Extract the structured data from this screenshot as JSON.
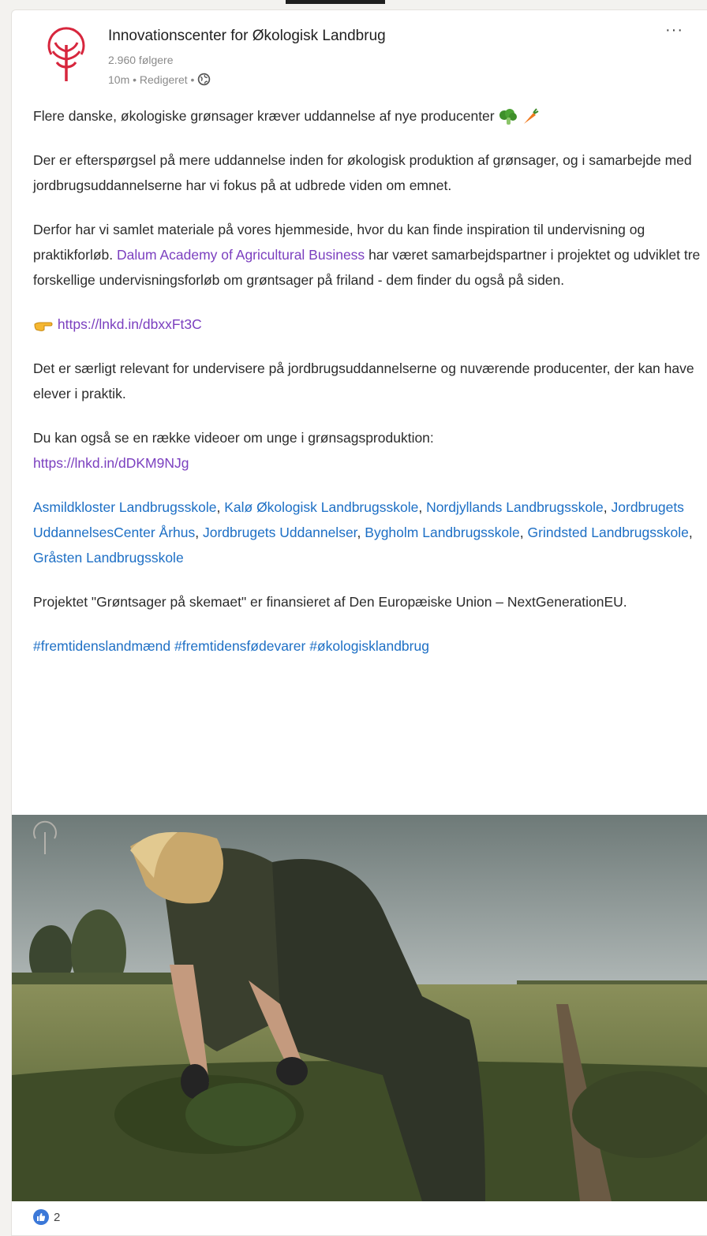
{
  "post": {
    "org_name": "Innovationscenter for Økologisk Landbrug",
    "followers": "2.960 følgere",
    "meta": "10m • Redigeret •",
    "more_label": "···",
    "headline": "Flere danske, økologiske grønsager kræver uddannelse af nye producenter",
    "para1": "Der er efterspørgsel på mere uddannelse inden for økologisk produktion af grønsager, og i samarbejde med jordbrugsuddannelserne har vi fokus på at udbrede viden om emnet.",
    "para2_before": "Derfor har vi samlet materiale på vores hjemmeside, hvor du kan finde inspiration til undervisning og praktikforløb.",
    "para2_link": "Dalum Academy of Agricultural Business",
    "para2_after": "har været samarbejdspartner i projektet og udviklet tre forskellige undervisningsforløb om grøntsager på friland - dem finder du også på siden.",
    "link1": "https://lnkd.in/dbxxFt3C",
    "para3": "Det er særligt relevant for undervisere på jordbrugsuddannelserne og nuværende producenter, der kan have elever i praktik.",
    "para4": "Du kan også se en række videoer om unge i grønsagsproduktion:",
    "link2": "https://lnkd.in/dDKM9NJg",
    "schools": [
      "Asmildkloster Landbrugsskole",
      "Kalø Økologisk Landbrugsskole",
      "Nordjyllands Landbrugsskole",
      "Jordbrugets UddannelsesCenter Århus",
      "Jordbrugets Uddannelser",
      "Bygholm Landbrugsskole",
      "Grindsted Landbrugsskole",
      "Gråsten Landbrugsskole"
    ],
    "para5": "Projektet \"Grøntsager på skemaet\" er finansieret af Den Europæiske Union – NextGenerationEU.",
    "hashtags": [
      "#fremtidenslandmænd",
      "#fremtidensfødevarer",
      "#økologisklandbrug"
    ],
    "reaction_count": "2"
  },
  "icons": {
    "logo": "tree-sprout-logo",
    "globe": "globe-icon",
    "broccoli": "broccoli-emoji",
    "carrot": "carrot-emoji",
    "pointing": "pointing-hand-emoji",
    "like": "like-icon"
  },
  "colors": {
    "brand_red": "#d7263d",
    "link_purple": "#7b3fbf",
    "link_blue": "#1d6fc5"
  }
}
